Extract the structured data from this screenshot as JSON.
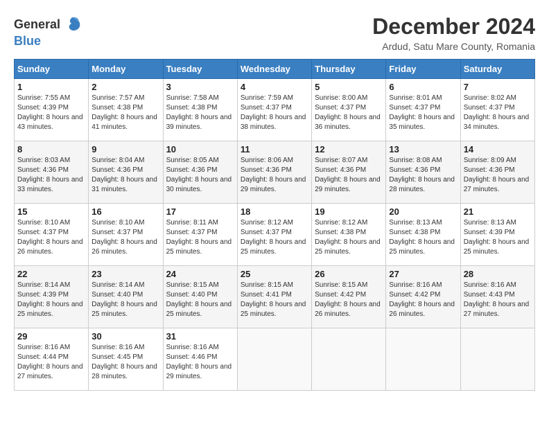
{
  "logo": {
    "text_general": "General",
    "text_blue": "Blue"
  },
  "title": "December 2024",
  "subtitle": "Ardud, Satu Mare County, Romania",
  "weekdays": [
    "Sunday",
    "Monday",
    "Tuesday",
    "Wednesday",
    "Thursday",
    "Friday",
    "Saturday"
  ],
  "weeks": [
    [
      {
        "day": "1",
        "sunrise": "7:55 AM",
        "sunset": "4:39 PM",
        "daylight": "8 hours and 43 minutes."
      },
      {
        "day": "2",
        "sunrise": "7:57 AM",
        "sunset": "4:38 PM",
        "daylight": "8 hours and 41 minutes."
      },
      {
        "day": "3",
        "sunrise": "7:58 AM",
        "sunset": "4:38 PM",
        "daylight": "8 hours and 39 minutes."
      },
      {
        "day": "4",
        "sunrise": "7:59 AM",
        "sunset": "4:37 PM",
        "daylight": "8 hours and 38 minutes."
      },
      {
        "day": "5",
        "sunrise": "8:00 AM",
        "sunset": "4:37 PM",
        "daylight": "8 hours and 36 minutes."
      },
      {
        "day": "6",
        "sunrise": "8:01 AM",
        "sunset": "4:37 PM",
        "daylight": "8 hours and 35 minutes."
      },
      {
        "day": "7",
        "sunrise": "8:02 AM",
        "sunset": "4:37 PM",
        "daylight": "8 hours and 34 minutes."
      }
    ],
    [
      {
        "day": "8",
        "sunrise": "8:03 AM",
        "sunset": "4:36 PM",
        "daylight": "8 hours and 33 minutes."
      },
      {
        "day": "9",
        "sunrise": "8:04 AM",
        "sunset": "4:36 PM",
        "daylight": "8 hours and 31 minutes."
      },
      {
        "day": "10",
        "sunrise": "8:05 AM",
        "sunset": "4:36 PM",
        "daylight": "8 hours and 30 minutes."
      },
      {
        "day": "11",
        "sunrise": "8:06 AM",
        "sunset": "4:36 PM",
        "daylight": "8 hours and 29 minutes."
      },
      {
        "day": "12",
        "sunrise": "8:07 AM",
        "sunset": "4:36 PM",
        "daylight": "8 hours and 29 minutes."
      },
      {
        "day": "13",
        "sunrise": "8:08 AM",
        "sunset": "4:36 PM",
        "daylight": "8 hours and 28 minutes."
      },
      {
        "day": "14",
        "sunrise": "8:09 AM",
        "sunset": "4:36 PM",
        "daylight": "8 hours and 27 minutes."
      }
    ],
    [
      {
        "day": "15",
        "sunrise": "8:10 AM",
        "sunset": "4:37 PM",
        "daylight": "8 hours and 26 minutes."
      },
      {
        "day": "16",
        "sunrise": "8:10 AM",
        "sunset": "4:37 PM",
        "daylight": "8 hours and 26 minutes."
      },
      {
        "day": "17",
        "sunrise": "8:11 AM",
        "sunset": "4:37 PM",
        "daylight": "8 hours and 25 minutes."
      },
      {
        "day": "18",
        "sunrise": "8:12 AM",
        "sunset": "4:37 PM",
        "daylight": "8 hours and 25 minutes."
      },
      {
        "day": "19",
        "sunrise": "8:12 AM",
        "sunset": "4:38 PM",
        "daylight": "8 hours and 25 minutes."
      },
      {
        "day": "20",
        "sunrise": "8:13 AM",
        "sunset": "4:38 PM",
        "daylight": "8 hours and 25 minutes."
      },
      {
        "day": "21",
        "sunrise": "8:13 AM",
        "sunset": "4:39 PM",
        "daylight": "8 hours and 25 minutes."
      }
    ],
    [
      {
        "day": "22",
        "sunrise": "8:14 AM",
        "sunset": "4:39 PM",
        "daylight": "8 hours and 25 minutes."
      },
      {
        "day": "23",
        "sunrise": "8:14 AM",
        "sunset": "4:40 PM",
        "daylight": "8 hours and 25 minutes."
      },
      {
        "day": "24",
        "sunrise": "8:15 AM",
        "sunset": "4:40 PM",
        "daylight": "8 hours and 25 minutes."
      },
      {
        "day": "25",
        "sunrise": "8:15 AM",
        "sunset": "4:41 PM",
        "daylight": "8 hours and 25 minutes."
      },
      {
        "day": "26",
        "sunrise": "8:15 AM",
        "sunset": "4:42 PM",
        "daylight": "8 hours and 26 minutes."
      },
      {
        "day": "27",
        "sunrise": "8:16 AM",
        "sunset": "4:42 PM",
        "daylight": "8 hours and 26 minutes."
      },
      {
        "day": "28",
        "sunrise": "8:16 AM",
        "sunset": "4:43 PM",
        "daylight": "8 hours and 27 minutes."
      }
    ],
    [
      {
        "day": "29",
        "sunrise": "8:16 AM",
        "sunset": "4:44 PM",
        "daylight": "8 hours and 27 minutes."
      },
      {
        "day": "30",
        "sunrise": "8:16 AM",
        "sunset": "4:45 PM",
        "daylight": "8 hours and 28 minutes."
      },
      {
        "day": "31",
        "sunrise": "8:16 AM",
        "sunset": "4:46 PM",
        "daylight": "8 hours and 29 minutes."
      },
      null,
      null,
      null,
      null
    ]
  ]
}
